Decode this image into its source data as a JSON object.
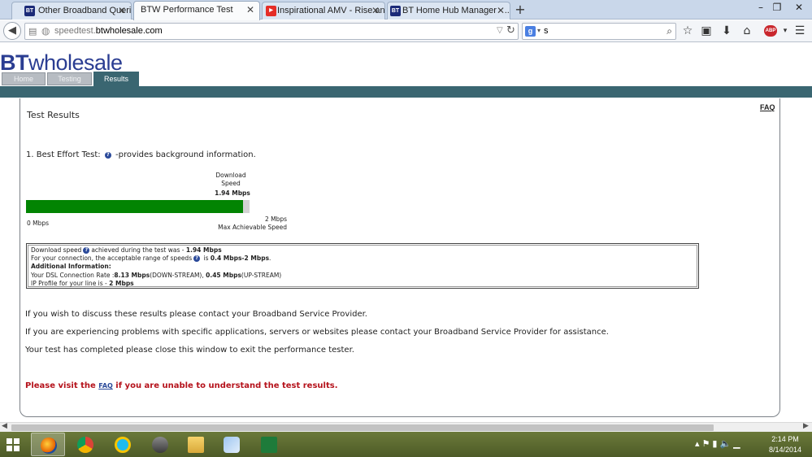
{
  "browser": {
    "tabs": [
      {
        "title": "Other Broadband Queries -...",
        "favicon": "BT",
        "favicon_color": "#1b2a78",
        "active": false
      },
      {
        "title": "BTW Performance Test",
        "favicon": "",
        "favicon_color": "",
        "active": true
      },
      {
        "title": "Inspirational AMV - Rise an...",
        "favicon": "▶",
        "favicon_color": "#e52d27",
        "active": false
      },
      {
        "title": "BT Home Hub Manager - ...",
        "favicon": "BT",
        "favicon_color": "#1b2a78",
        "active": false
      }
    ],
    "new_tab": "+",
    "url_prefix": "speedtest.",
    "url_domain": "btwholesale.com",
    "search_query": "s"
  },
  "site": {
    "logo_bt": "BT",
    "logo_wholesale": "wholesale",
    "nav": {
      "home": "Home",
      "testing": "Testing",
      "results": "Results"
    },
    "brand_color": "#2a3d92",
    "bar_color": "#3a6671"
  },
  "results": {
    "faq": "FAQ",
    "title": "Test Results",
    "best_effort_label": "1. Best Effort Test:",
    "best_effort_desc": "-provides background information.",
    "download_label_line1": "Download",
    "download_label_line2": "Speed",
    "download_speed": "1.94 Mbps",
    "speed_fraction": 0.97,
    "min_label": "0 Mbps",
    "max_value": "2 Mbps",
    "max_label": "Max Achievable Speed",
    "bar_color": "#028402",
    "info": {
      "line1_prefix": "Download speed",
      "line1_mid": "achieved during the test was - ",
      "line1_value": "1.94 Mbps",
      "line2_prefix": "For your connection, the acceptable range of speeds",
      "line2_mid": " is ",
      "line2_value": "0.4 Mbps-2 Mbps",
      "line2_end": ".",
      "heading": "Additional Information:",
      "line4_prefix": "Your DSL Connection Rate :",
      "line4_down": "8.13 Mbps",
      "line4_down_label": "(DOWN-STREAM), ",
      "line4_up": "0.45 Mbps",
      "line4_up_label": "(UP-STREAM)",
      "line5_prefix": "IP Profile for your line is - ",
      "line5_value": "2 Mbps"
    },
    "msg1": "If you wish to discuss these results please contact your Broadband Service Provider.",
    "msg2": "If you are experiencing problems with specific applications, servers or websites please contact your Broadband Service Provider for assistance.",
    "msg3": "Your test has completed please close this window to exit the performance tester.",
    "faq_prompt_prefix": "Please visit the ",
    "faq_prompt_link": "FAQ",
    "faq_prompt_suffix": " if you are unable to understand the test results.",
    "warning_color": "#b5121b"
  },
  "taskbar": {
    "time": "2:14 PM",
    "date": "8/14/2014"
  }
}
